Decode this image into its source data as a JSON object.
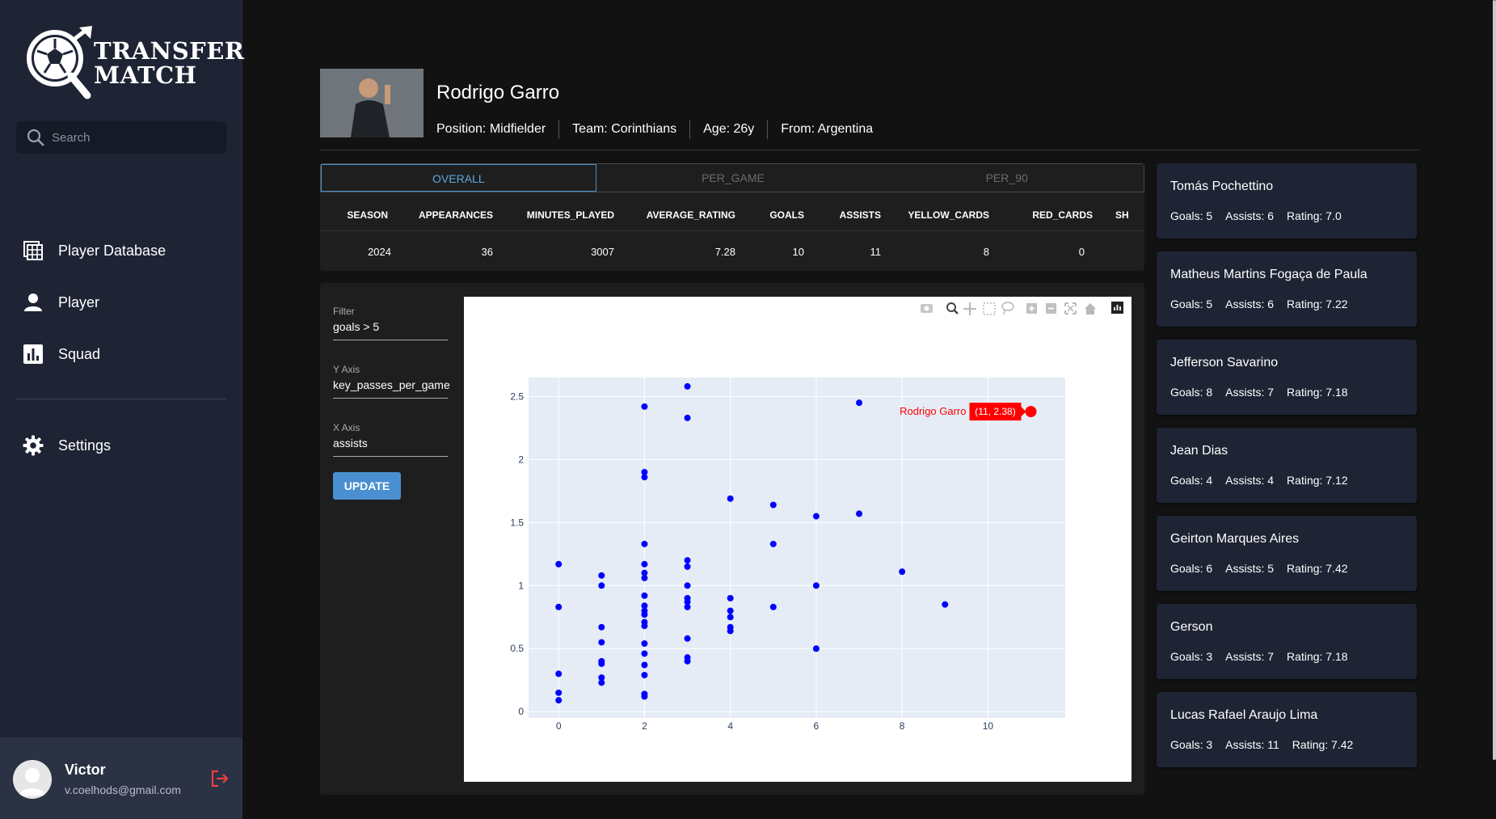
{
  "app": {
    "logo_line1": "TRANSFER",
    "logo_line2": "MATCH"
  },
  "sidebar": {
    "search_placeholder": "Search",
    "nav": [
      {
        "label": "Player Database",
        "icon": "table-icon"
      },
      {
        "label": "Player",
        "icon": "person-icon"
      },
      {
        "label": "Squad",
        "icon": "bar-chart-icon"
      },
      {
        "label": "Settings",
        "icon": "gear-icon"
      }
    ],
    "user": {
      "name": "Victor",
      "email": "v.coelhods@gmail.com"
    }
  },
  "player": {
    "name": "Rodrigo Garro",
    "position": "Position: Midfielder",
    "team": "Team: Corinthians",
    "age": "Age: 26y",
    "from": "From: Argentina"
  },
  "stats": {
    "tabs": [
      "OVERALL",
      "PER_GAME",
      "PER_90"
    ],
    "active_tab": "OVERALL",
    "columns": [
      "SEASON",
      "APPEARANCES",
      "MINUTES_PLAYED",
      "AVERAGE_RATING",
      "GOALS",
      "ASSISTS",
      "YELLOW_CARDS",
      "RED_CARDS",
      "SH"
    ],
    "rows": [
      [
        "2024",
        "36",
        "3007",
        "7.28",
        "10",
        "11",
        "8",
        "0",
        ""
      ]
    ]
  },
  "controls": {
    "filter_label": "Filter",
    "filter_value": "goals > 5",
    "y_label": "Y Axis",
    "y_value": "key_passes_per_game",
    "x_label": "X Axis",
    "x_value": "assists",
    "update_label": "UPDATE"
  },
  "colors": {
    "point": "#0000ff",
    "highlight": "#ff0000",
    "plot_bg": "#e5ecf6",
    "accent": "#4a8fd0"
  },
  "chart_data": {
    "type": "scatter",
    "xlabel": "",
    "ylabel": "",
    "xlim": [
      -0.7,
      11.8
    ],
    "ylim": [
      -0.05,
      2.65
    ],
    "xticks": [
      "0",
      "2",
      "4",
      "6",
      "8",
      "10"
    ],
    "yticks": [
      "0",
      "0.5",
      "1",
      "1.5",
      "2",
      "2.5"
    ],
    "points": [
      [
        0,
        1.17
      ],
      [
        0,
        0.83
      ],
      [
        0,
        0.3
      ],
      [
        0,
        0.15
      ],
      [
        0,
        0.09
      ],
      [
        1,
        1.08
      ],
      [
        1,
        1.0
      ],
      [
        1,
        0.67
      ],
      [
        1,
        0.55
      ],
      [
        1,
        0.4
      ],
      [
        1,
        0.38
      ],
      [
        1,
        0.27
      ],
      [
        1,
        0.23
      ],
      [
        2,
        2.42
      ],
      [
        2,
        1.9
      ],
      [
        2,
        1.86
      ],
      [
        2,
        1.33
      ],
      [
        2,
        1.17
      ],
      [
        2,
        1.1
      ],
      [
        2,
        1.06
      ],
      [
        2,
        0.92
      ],
      [
        2,
        0.84
      ],
      [
        2,
        0.8
      ],
      [
        2,
        0.77
      ],
      [
        2,
        0.71
      ],
      [
        2,
        0.68
      ],
      [
        2,
        0.54
      ],
      [
        2,
        0.46
      ],
      [
        2,
        0.37
      ],
      [
        2,
        0.29
      ],
      [
        2,
        0.14
      ],
      [
        2,
        0.12
      ],
      [
        3,
        2.58
      ],
      [
        3,
        2.33
      ],
      [
        3,
        1.2
      ],
      [
        3,
        1.15
      ],
      [
        3,
        1.0
      ],
      [
        3,
        0.9
      ],
      [
        3,
        0.87
      ],
      [
        3,
        0.83
      ],
      [
        3,
        0.58
      ],
      [
        3,
        0.43
      ],
      [
        3,
        0.4
      ],
      [
        4,
        1.69
      ],
      [
        4,
        0.9
      ],
      [
        4,
        0.8
      ],
      [
        4,
        0.75
      ],
      [
        4,
        0.67
      ],
      [
        4,
        0.64
      ],
      [
        5,
        1.64
      ],
      [
        5,
        1.33
      ],
      [
        5,
        0.83
      ],
      [
        6,
        1.55
      ],
      [
        6,
        1.0
      ],
      [
        6,
        0.5
      ],
      [
        7,
        2.45
      ],
      [
        7,
        1.57
      ],
      [
        8,
        1.11
      ],
      [
        9,
        0.85
      ]
    ],
    "highlight": {
      "label": "Rodrigo Garro",
      "hover": "(11, 2.38)",
      "x": 11,
      "y": 2.38
    }
  },
  "similar_players": [
    {
      "name": "Tomás Pochettino",
      "goals": "Goals: 5",
      "assists": "Assists: 6",
      "rating": "Rating: 7.0"
    },
    {
      "name": "Matheus Martins Fogaça de Paula",
      "goals": "Goals: 5",
      "assists": "Assists: 6",
      "rating": "Rating: 7.22"
    },
    {
      "name": "Jefferson Savarino",
      "goals": "Goals: 8",
      "assists": "Assists: 7",
      "rating": "Rating: 7.18"
    },
    {
      "name": "Jean Dias",
      "goals": "Goals: 4",
      "assists": "Assists: 4",
      "rating": "Rating: 7.12"
    },
    {
      "name": "Geirton Marques Aires",
      "goals": "Goals: 6",
      "assists": "Assists: 5",
      "rating": "Rating: 7.42"
    },
    {
      "name": "Gerson",
      "goals": "Goals: 3",
      "assists": "Assists: 7",
      "rating": "Rating: 7.18"
    },
    {
      "name": "Lucas Rafael Araujo Lima",
      "goals": "Goals: 3",
      "assists": "Assists: 11",
      "rating": "Rating: 7.42"
    }
  ]
}
